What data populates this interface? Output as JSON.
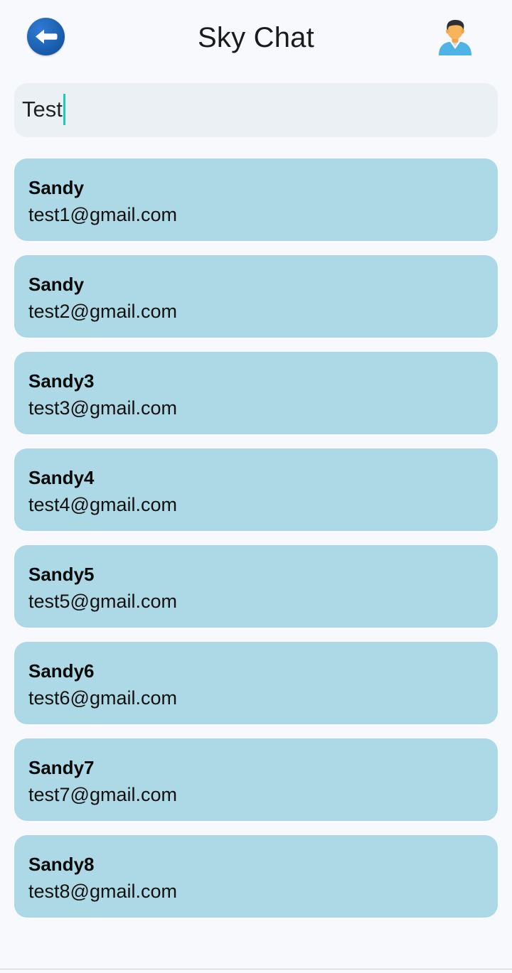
{
  "header": {
    "title": "Sky Chat",
    "back_icon": "arrow-left-circle-icon",
    "profile_icon": "user-avatar-icon"
  },
  "search": {
    "value": "Test",
    "caret_color": "#20c9b8"
  },
  "colors": {
    "background": "#f7f9fc",
    "card": "#add8e6",
    "search_bg": "#eaf0f4",
    "back_button": "#1b5fb0"
  },
  "users": [
    {
      "name": "Sandy",
      "email": "test1@gmail.com"
    },
    {
      "name": "Sandy",
      "email": "test2@gmail.com"
    },
    {
      "name": "Sandy3",
      "email": "test3@gmail.com"
    },
    {
      "name": "Sandy4",
      "email": "test4@gmail.com"
    },
    {
      "name": "Sandy5",
      "email": "test5@gmail.com"
    },
    {
      "name": "Sandy6",
      "email": "test6@gmail.com"
    },
    {
      "name": "Sandy7",
      "email": "test7@gmail.com"
    },
    {
      "name": "Sandy8",
      "email": "test8@gmail.com"
    }
  ]
}
